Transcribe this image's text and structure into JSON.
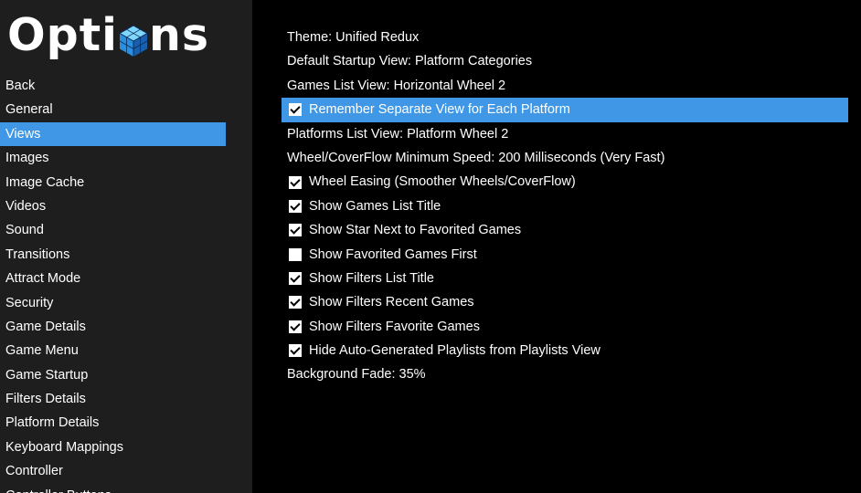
{
  "sidebar": {
    "title_before": "Opti",
    "title_after": "ns",
    "logo_icon": "launchbox-cube-icon",
    "items": [
      {
        "label": "Back"
      },
      {
        "label": "General"
      },
      {
        "label": "Views",
        "active": true
      },
      {
        "label": "Images"
      },
      {
        "label": "Image Cache"
      },
      {
        "label": "Videos"
      },
      {
        "label": "Sound"
      },
      {
        "label": "Transitions"
      },
      {
        "label": "Attract Mode"
      },
      {
        "label": "Security"
      },
      {
        "label": "Game Details"
      },
      {
        "label": "Game Menu"
      },
      {
        "label": "Game Startup"
      },
      {
        "label": "Filters Details"
      },
      {
        "label": "Platform Details"
      },
      {
        "label": "Keyboard Mappings"
      },
      {
        "label": "Controller"
      },
      {
        "label": "Controller Buttons"
      }
    ]
  },
  "settings": [
    {
      "label": "Theme: Unified Redux"
    },
    {
      "label": "Default Startup View: Platform Categories"
    },
    {
      "label": "Games List View: Horizontal Wheel 2"
    },
    {
      "label": "Remember Separate View for Each Platform",
      "checked": true,
      "active": true
    },
    {
      "label": "Platforms List View: Platform Wheel 2"
    },
    {
      "label": "Wheel/CoverFlow Minimum Speed: 200 Milliseconds (Very Fast)"
    },
    {
      "label": "Wheel Easing (Smoother Wheels/CoverFlow)",
      "checked": true
    },
    {
      "label": "Show Games List Title",
      "checked": true
    },
    {
      "label": "Show Star Next to Favorited Games",
      "checked": true
    },
    {
      "label": "Show Favorited Games First",
      "checked": false
    },
    {
      "label": "Show Filters List Title",
      "checked": true
    },
    {
      "label": "Show Filters Recent Games",
      "checked": true
    },
    {
      "label": "Show Filters Favorite Games",
      "checked": true
    },
    {
      "label": "Hide Auto-Generated Playlists from Playlists View",
      "checked": true
    },
    {
      "label": "Background Fade: 35%"
    }
  ],
  "colors": {
    "accent": "#3f97e6",
    "sidebar_bg": "#1e1e1e",
    "content_bg": "#000000"
  }
}
